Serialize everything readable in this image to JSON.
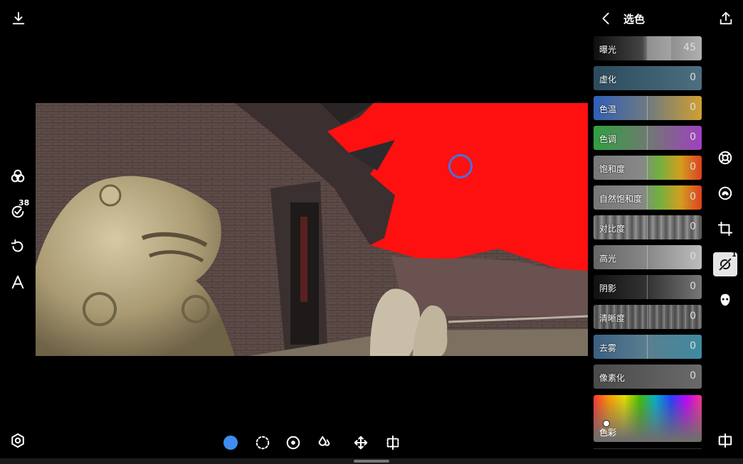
{
  "panel": {
    "title": "选色",
    "sliders": [
      {
        "label": "曝光",
        "value": "45"
      },
      {
        "label": "虚化",
        "value": "0"
      },
      {
        "label": "色温",
        "value": "0"
      },
      {
        "label": "色调",
        "value": "0"
      },
      {
        "label": "饱和度",
        "value": "0"
      },
      {
        "label": "自然饱和度",
        "value": "0"
      },
      {
        "label": "对比度",
        "value": "0"
      },
      {
        "label": "高光",
        "value": "0"
      },
      {
        "label": "阴影",
        "value": "0"
      },
      {
        "label": "清晰度",
        "value": "0"
      },
      {
        "label": "去雾",
        "value": "0"
      },
      {
        "label": "像素化",
        "value": "0"
      }
    ],
    "color_pad_label": "色彩"
  },
  "left_tools": {
    "history_badge": "38"
  },
  "right_tools": {
    "selective_badge": "1"
  },
  "colors": {
    "selection_mask": "#ff1010",
    "accent_blue": "#3d8ef0"
  },
  "icons": {
    "top_left": "download-icon",
    "top_right": "share-icon",
    "back": "chevron-left-icon"
  }
}
